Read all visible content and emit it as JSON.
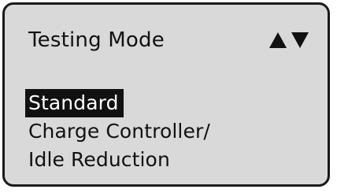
{
  "display": {
    "title": "Testing Mode",
    "scroll_arrows": {
      "up_icon": "triangle-up-icon",
      "down_icon": "triangle-down-icon"
    },
    "menu": [
      {
        "label": "Standard",
        "selected": true
      },
      {
        "label": "Charge Controller/",
        "selected": false
      },
      {
        "label": "Idle Reduction",
        "selected": false
      }
    ],
    "colors": {
      "screen_background": "#d9d9d9",
      "text": "#111111",
      "highlight": "#111111",
      "highlight_text": "#ffffff"
    }
  }
}
